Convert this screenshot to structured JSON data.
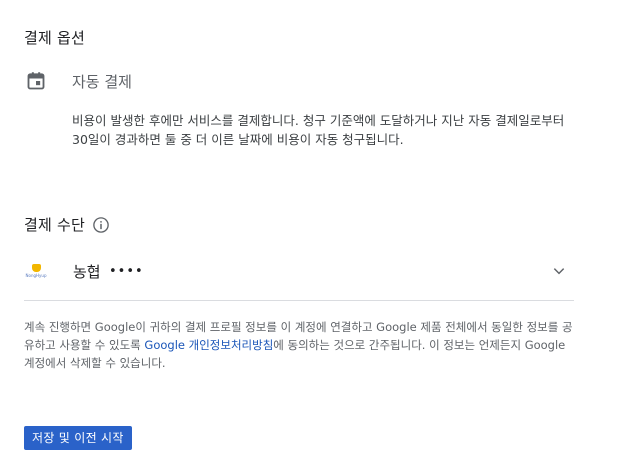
{
  "payment_options": {
    "title": "결제 옵션",
    "calendar_icon": "calendar-icon",
    "autopay_label": "자동 결제",
    "autopay_description": "비용이 발생한 후에만 서비스를 결제합니다. 청구 기준액에 도달하거나 지난 자동 결제일로부터 30일이 경과하면 둘 중 더 이른 날짜에 비용이 자동 청구됩니다."
  },
  "payment_method": {
    "title": "결제 수단",
    "info_icon": "info-icon",
    "selected": {
      "bank_name": "농협",
      "masked_number": "••••",
      "logo_icon": "nonghyup-logo-icon",
      "logo_caption": "NongHyup"
    },
    "chevron_icon": "chevron-down-icon"
  },
  "legal": {
    "text_before_link": "계속 진행하면 Google이 귀하의 결제 프로필 정보를 이 계정에 연결하고 Google 제품 전체에서 동일한 정보를 공유하고 사용할 수 있도록 ",
    "link_text": "Google 개인정보처리방침",
    "text_after_link": "에 동의하는 것으로 간주됩니다. 이 정보는 언제든지 Google 계정에서 삭제할 수 있습니다."
  },
  "actions": {
    "save_label": "저장 및 이전 시작"
  },
  "colors": {
    "primary_button": "#2a62c9",
    "link": "#1a55b8",
    "icon": "#5f6368"
  }
}
